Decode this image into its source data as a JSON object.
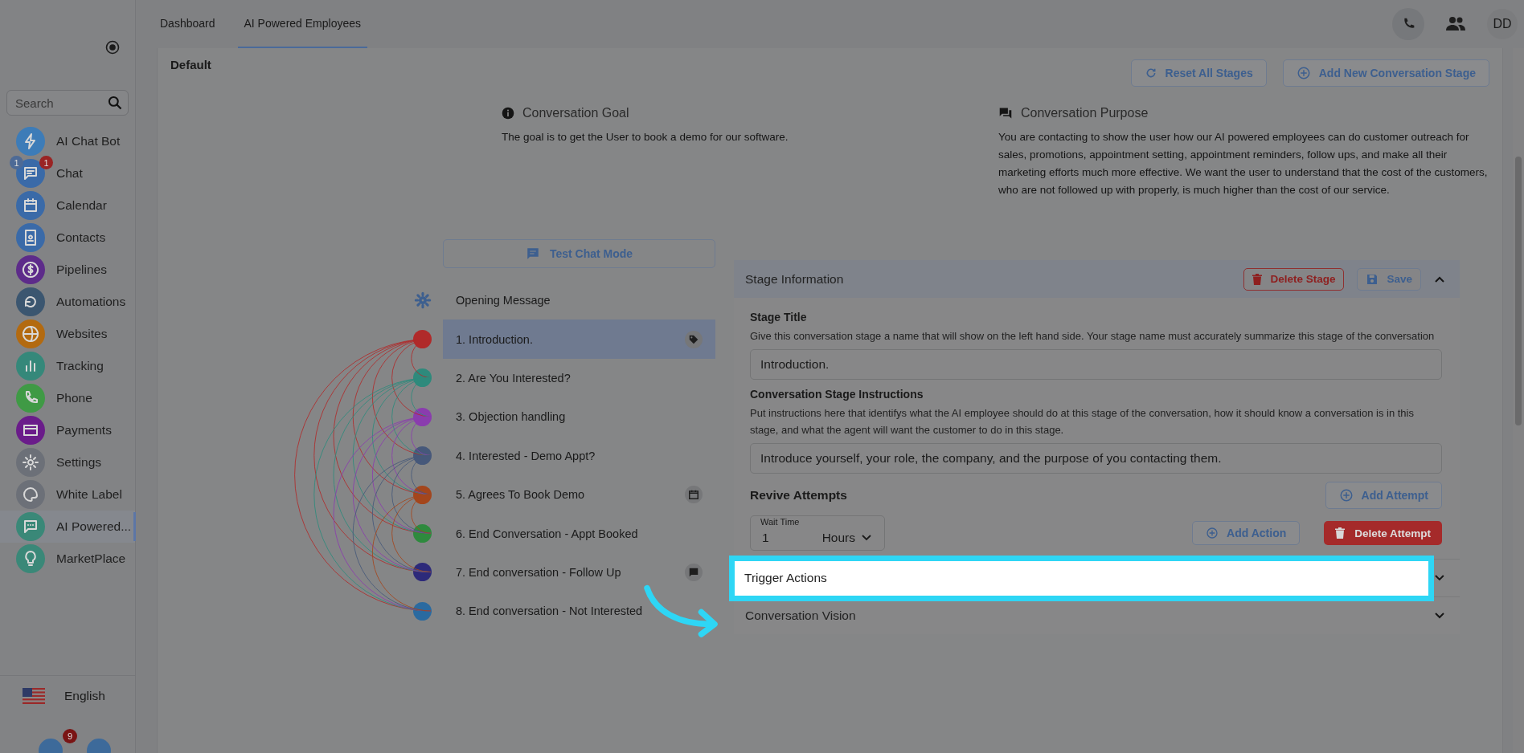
{
  "sidebar": {
    "search": {
      "placeholder": "Search"
    },
    "items": [
      {
        "label": "AI Chat Bot",
        "kind": "bolt",
        "color": "#3d7cb8",
        "selected": false
      },
      {
        "label": "Chat",
        "kind": "chat",
        "color": "#3a6aa8",
        "selected": false,
        "badges": [
          "1",
          "1"
        ]
      },
      {
        "label": "Calendar",
        "kind": "calendar",
        "color": "#3a6aa8",
        "selected": false
      },
      {
        "label": "Contacts",
        "kind": "contact",
        "color": "#3a6aa8",
        "selected": false
      },
      {
        "label": "Pipelines",
        "kind": "dollar",
        "color": "#5d2b8a",
        "selected": false
      },
      {
        "label": "Automations",
        "kind": "cycle",
        "color": "#3b5670",
        "selected": false
      },
      {
        "label": "Websites",
        "kind": "globe",
        "color": "#b36a10",
        "selected": false
      },
      {
        "label": "Tracking",
        "kind": "bars",
        "color": "#35887a",
        "selected": false
      },
      {
        "label": "Phone",
        "kind": "phone",
        "color": "#3f9a45",
        "selected": false
      },
      {
        "label": "Payments",
        "kind": "card",
        "color": "#6a1c8a",
        "selected": false
      },
      {
        "label": "Settings",
        "kind": "gear",
        "color": "#6c7078",
        "selected": false
      },
      {
        "label": "White Label",
        "kind": "palette",
        "color": "#6c7078",
        "selected": false
      },
      {
        "label": "AI Powered...",
        "kind": "message",
        "color": "#3a8878",
        "selected": true
      },
      {
        "label": "MarketPlace",
        "kind": "bulb",
        "color": "#3a8878",
        "selected": false
      }
    ],
    "language": "English",
    "notification_count": "9"
  },
  "topbar": {
    "tabs": [
      {
        "label": "Dashboard",
        "selected": false
      },
      {
        "label": "AI Powered Employees",
        "selected": true
      }
    ],
    "avatar": "DD"
  },
  "page": {
    "title": "Default",
    "buttons": [
      "Reset All Stages",
      "Add New Conversation Stage"
    ],
    "goal": {
      "label": "Conversation Goal",
      "text": "The goal is to get the User to book a demo for our software."
    },
    "purpose": {
      "label": "Conversation Purpose",
      "text": "You are contacting to show the user how our AI powered employees can do customer outreach for sales, promotions, appointment setting, appointment reminders, follow ups, and make all their marketing efforts much more effective. We want the user to understand that the cost of the customers, who are not followed up with properly, is much higher than the cost of our service."
    },
    "test_button": "Test Chat Mode",
    "opening_message": "Opening Message",
    "stages": [
      {
        "label": "1. Introduction.",
        "color": "#b02a2a",
        "selected": true,
        "kind": "tag"
      },
      {
        "label": "2. Are You Interested?",
        "color": "#2e8a7c",
        "selected": false,
        "kind": "plain"
      },
      {
        "label": "3. Objection handling",
        "color": "#8a3cae",
        "selected": false,
        "kind": "plain"
      },
      {
        "label": "4. Interested - Demo Appt?",
        "color": "#46587a",
        "selected": false,
        "kind": "plain"
      },
      {
        "label": "5. Agrees To Book Demo",
        "color": "#a4461c",
        "selected": false,
        "kind": "calendar"
      },
      {
        "label": "6. End Conversation - Appt Booked",
        "color": "#2e8a3e",
        "selected": false,
        "kind": "plain"
      },
      {
        "label": "7. End conversation - Follow Up",
        "color": "#2d2a7a",
        "selected": false,
        "kind": "message"
      },
      {
        "label": "8. End conversation - Not Interested",
        "color": "#2a6aa0",
        "selected": false,
        "kind": "plain"
      }
    ]
  },
  "stage_panel": {
    "title": "Stage Information",
    "delete": "Delete Stage",
    "save": "Save",
    "expanded": true,
    "fields": [
      {
        "label": "Stage Title",
        "help": "Give this conversation stage a name that will show on the left hand side. Your stage name must accurately summarize this stage of the conversation",
        "value": "Introduction."
      },
      {
        "label": "Conversation Stage Instructions",
        "help": "Put instructions here that identifys what the AI employee should do at this stage of the conversation, how it should know a conversation is in this stage, and what the agent will want the customer to do in this stage.",
        "value": "Introduce yourself, your role, the company, and the purpose of you contacting them."
      }
    ],
    "revive": {
      "title": "Revive Attempts",
      "add_attempt": "Add Attempt",
      "wait_label": "Wait Time",
      "wait_value": "1",
      "unit": "Hours",
      "add_action": "Add Action",
      "delete_attempt": "Delete Attempt"
    },
    "sections": [
      {
        "title": "Trigger Actions",
        "highlighted": true
      },
      {
        "title": "Conversation Vision",
        "highlighted": false
      }
    ]
  }
}
